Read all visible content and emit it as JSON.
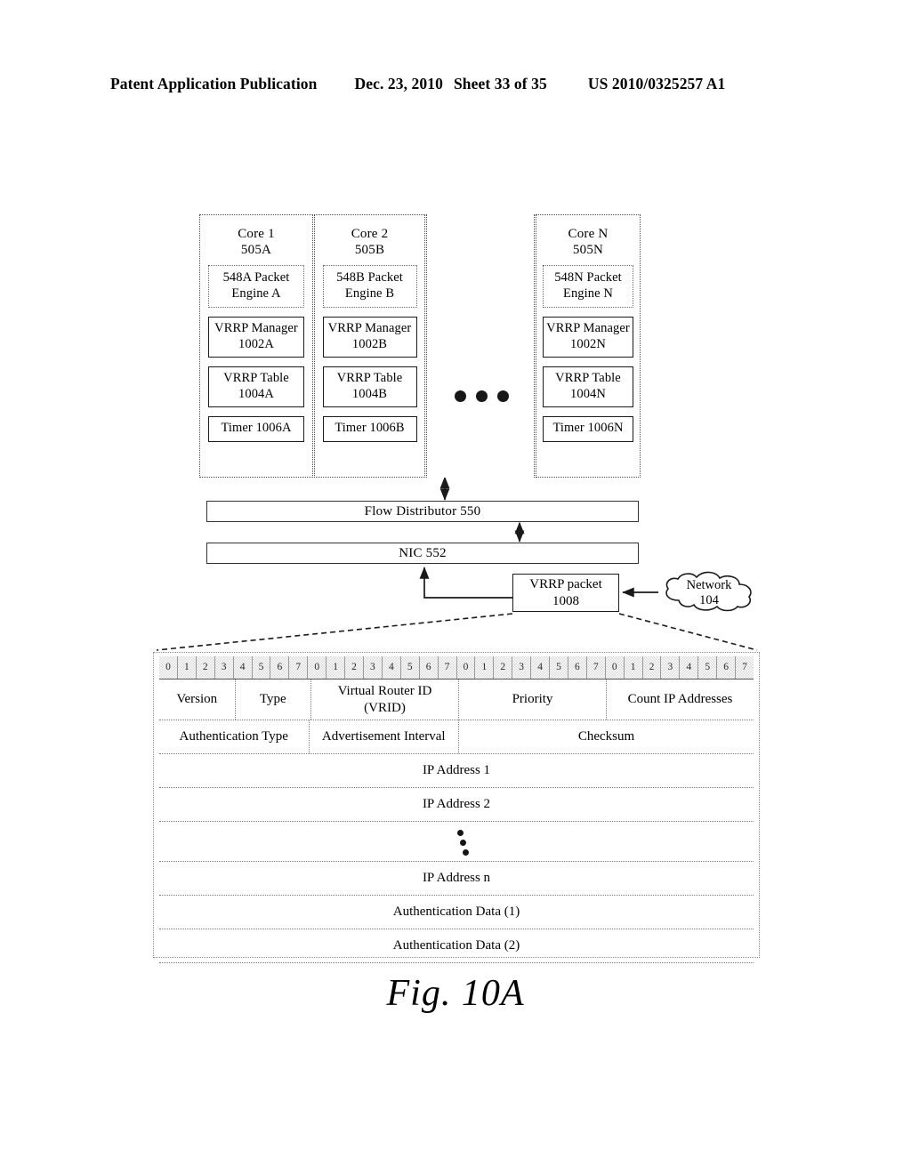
{
  "header": {
    "publication": "Patent Application Publication",
    "date": "Dec. 23, 2010",
    "sheet": "Sheet 33 of 35",
    "patent_number": "US 2010/0325257 A1"
  },
  "figure": {
    "caption": "Fig. 10A"
  },
  "cores": [
    {
      "id": "core-1",
      "title": "Core 1",
      "ref": "505A",
      "packet_engine": {
        "ref": "548A",
        "name": "Packet Engine",
        "suffix": "A"
      },
      "vrrp_manager": {
        "line1": "VRRP",
        "line2": "Manager",
        "ref": "1002A"
      },
      "vrrp_table": {
        "line1": "VRRP Table",
        "ref": "1004A"
      },
      "timer": {
        "label": "Timer 1006A"
      }
    },
    {
      "id": "core-2",
      "title": "Core 2",
      "ref": "505B",
      "packet_engine": {
        "ref": "548B",
        "name": "Packet Engine",
        "suffix": "B"
      },
      "vrrp_manager": {
        "line1": "VRRP",
        "line2": "Manager",
        "ref": "1002B"
      },
      "vrrp_table": {
        "line1": "VRRP Table",
        "ref": "1004B"
      },
      "timer": {
        "label": "Timer 1006B"
      }
    },
    {
      "id": "core-n",
      "title": "Core N",
      "ref": "505N",
      "packet_engine": {
        "ref": "548N",
        "name": "Packet Engine",
        "suffix": "N"
      },
      "vrrp_manager": {
        "line1": "VRRP",
        "line2": "Manager",
        "ref": "1002N"
      },
      "vrrp_table": {
        "line1": "VRRP Table",
        "ref": "1004N"
      },
      "timer": {
        "label": "Timer 1006N"
      }
    }
  ],
  "blocks": {
    "flow_distributor": "Flow Distributor 550",
    "nic": "NIC 552",
    "vrrp_packet": {
      "line1": "VRRP packet",
      "ref": "1008"
    },
    "network": {
      "line1": "Network",
      "ref": "104"
    }
  },
  "packet_format": {
    "bit_ruler": [
      "0",
      "1",
      "2",
      "3",
      "4",
      "5",
      "6",
      "7",
      "0",
      "1",
      "2",
      "3",
      "4",
      "5",
      "6",
      "7",
      "0",
      "1",
      "2",
      "3",
      "4",
      "5",
      "6",
      "7",
      "0",
      "1",
      "2",
      "3",
      "4",
      "5",
      "6",
      "7"
    ],
    "row1": [
      {
        "label": "Version",
        "bits": 4
      },
      {
        "label": "Type",
        "bits": 4
      },
      {
        "label": "Virtual Router ID",
        "label2": "(VRID)",
        "bits": 8
      },
      {
        "label": "Priority",
        "bits": 8
      },
      {
        "label": "Count IP Addresses",
        "bits": 8
      }
    ],
    "row2": [
      {
        "label": "Authentication Type",
        "bits": 8
      },
      {
        "label": "Advertisement Interval",
        "bits": 8
      },
      {
        "label": "Checksum",
        "bits": 16
      }
    ],
    "full_rows": [
      "IP Address 1",
      "IP Address 2"
    ],
    "continuation_rows": [
      "IP Address n",
      "Authentication Data (1)",
      "Authentication Data (2)"
    ]
  }
}
